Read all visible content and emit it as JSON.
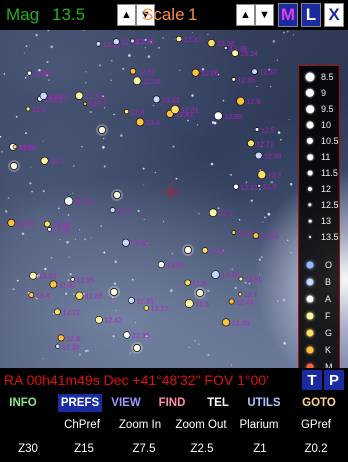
{
  "topbar": {
    "mag_label": "Mag",
    "mag_value": "13.5",
    "scale_label": "Scale",
    "scale_value": "1",
    "up_arrow": "▲",
    "down_arrow": "▼",
    "m_button": "M",
    "l_button": "L",
    "x_button": "X"
  },
  "sky": {
    "star_labels": [
      "12.46",
      "12.6",
      "12.5",
      "13.32",
      "11.35",
      "13.46",
      "10.73",
      "12.35",
      "13.05",
      "12.39",
      "12.1",
      "13.06",
      "13.14",
      "12.94",
      "13.27",
      "13.2",
      "13.38",
      "12.95",
      "11.52",
      "12.42",
      "13.46",
      "13.53",
      "13.49",
      "12.23",
      "12.44",
      "12.7",
      "13.36",
      "12.99",
      "13.57",
      "12.85",
      "12.37",
      "13.5",
      "12.65",
      "13.4",
      "12.42",
      "12.06",
      "13.1",
      "12.8",
      "12.3",
      "12.55",
      "12.95",
      "13.45",
      "12.15",
      "12.6",
      "12.5",
      "13.23",
      "12.72",
      "12.9",
      "13.3",
      "12.81",
      "12.71",
      "11.8",
      "12.46",
      "12.85",
      "12.6",
      "13.05",
      "12.37",
      "13.43",
      "12.87",
      "12.53",
      "13.28",
      "12.1",
      "13.54",
      "13.4"
    ]
  },
  "legend": {
    "magnitudes": [
      "8.5",
      "9",
      "9.5",
      "10",
      "10.5",
      "11",
      "11.5",
      "12",
      "12.5",
      "13",
      "13.5"
    ],
    "spectral": [
      {
        "label": "O",
        "color": "#9ab8ff"
      },
      {
        "label": "B",
        "color": "#c8d8ff"
      },
      {
        "label": "A",
        "color": "#ffffff"
      },
      {
        "label": "F",
        "color": "#fff6a0"
      },
      {
        "label": "G",
        "color": "#ffe060"
      },
      {
        "label": "K",
        "color": "#ffc040"
      },
      {
        "label": "M",
        "color": "#ff6040"
      }
    ]
  },
  "status": {
    "coords": "RA 00h41m49s Dec +41°48'32\" FOV  1°00'",
    "t_button": "T",
    "p_button": "P"
  },
  "menu": {
    "info": "INFO",
    "prefs": "PREFS",
    "view": "VIEW",
    "find": "FIND",
    "tel": "TEL",
    "utils": "UTILS",
    "goto": "GOTO"
  },
  "submenu": {
    "chpref": "ChPref",
    "zoom_in": "Zoom In",
    "zoom_out": "Zoom Out",
    "plarium": "Plarium",
    "gpref": "GPref"
  },
  "zoom": {
    "z30": "Z30",
    "z15": "Z15",
    "z7_5": "Z7.5",
    "z2_5": "Z2.5",
    "z1": "Z1",
    "z0_2": "Z0.2"
  },
  "colors": {
    "mag_green": "#22b022",
    "scale_orange": "#ff8a4a",
    "status_red": "#e01010",
    "label_magenta": "#b020c0",
    "button_blue": "#1a2aa0"
  }
}
